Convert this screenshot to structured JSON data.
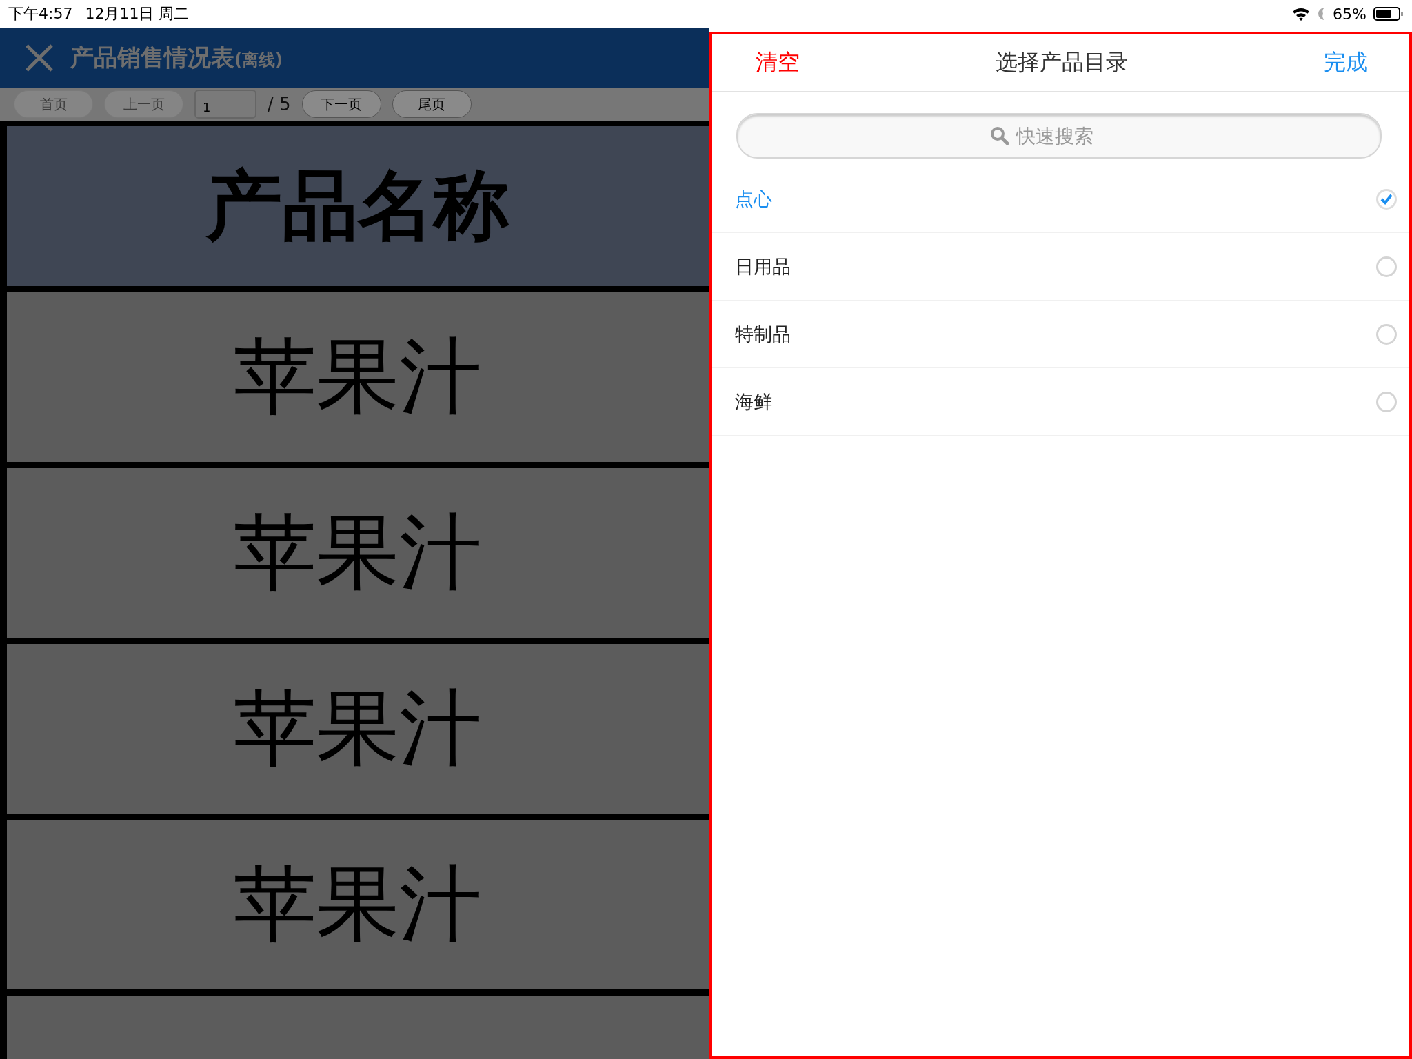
{
  "status_bar": {
    "time": "下午4:57",
    "date": "12月11日 周二",
    "battery": "65%"
  },
  "app": {
    "title": "产品销售情况表",
    "title_suffix": "(离线)",
    "pager": {
      "buttons": [
        {
          "label": "首页",
          "disabled": true
        },
        {
          "label": "上一页",
          "disabled": true
        }
      ],
      "page": "1",
      "total": "/ 5",
      "next_buttons": [
        {
          "label": "下一页",
          "disabled": false
        },
        {
          "label": "尾页",
          "disabled": false
        }
      ]
    },
    "table": {
      "header": "产品名称",
      "rows": [
        "苹果汁",
        "苹果汁",
        "苹果汁",
        "苹果汁"
      ]
    }
  },
  "picker": {
    "clear": "清空",
    "title": "选择产品目录",
    "done": "完成",
    "search": {
      "placeholder": "快速搜索"
    },
    "items": [
      {
        "label": "点心",
        "selected": true
      },
      {
        "label": "日用品",
        "selected": false
      },
      {
        "label": "特制品",
        "selected": false
      },
      {
        "label": "海鲜",
        "selected": false
      }
    ]
  }
}
